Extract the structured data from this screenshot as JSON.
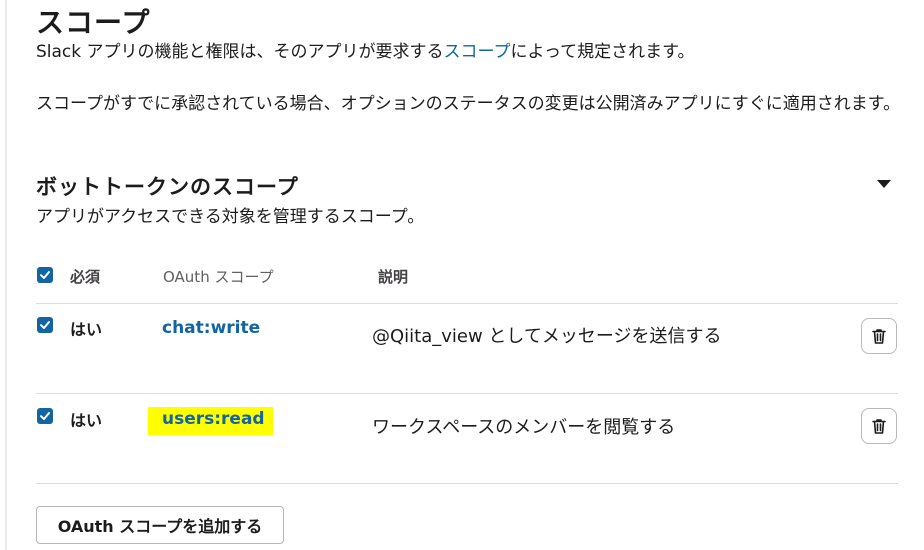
{
  "section": {
    "title": "スコープ",
    "intro_prefix": "Slack アプリの機能と権限は、そのアプリが要求する",
    "intro_link": "スコープ",
    "intro_suffix": "によって規定されます。",
    "notice": "スコープがすでに承認されている場合、オプションのステータスの変更は公開済みアプリにすぐに適用されます。"
  },
  "bot_scopes": {
    "title": "ボットトークンのスコープ",
    "description": "アプリがアクセスできる対象を管理するスコープ。",
    "columns": {
      "required": "必須",
      "scope": "OAuth スコープ",
      "description": "説明"
    },
    "rows": [
      {
        "required": "はい",
        "scope": "chat:write",
        "description": "@Qiita_view としてメッセージを送信する",
        "checked": true,
        "highlighted": false
      },
      {
        "required": "はい",
        "scope": "users:read",
        "description": "ワークスペースのメンバーを閲覧する",
        "checked": true,
        "highlighted": true
      }
    ],
    "add_button": "OAuth スコープを追加する"
  },
  "colors": {
    "accent": "#1264a3",
    "highlight": "#ffff00",
    "text": "#1d1c1d"
  },
  "icons": [
    "checkbox-checked-icon",
    "trash-icon",
    "caret-down-icon"
  ]
}
